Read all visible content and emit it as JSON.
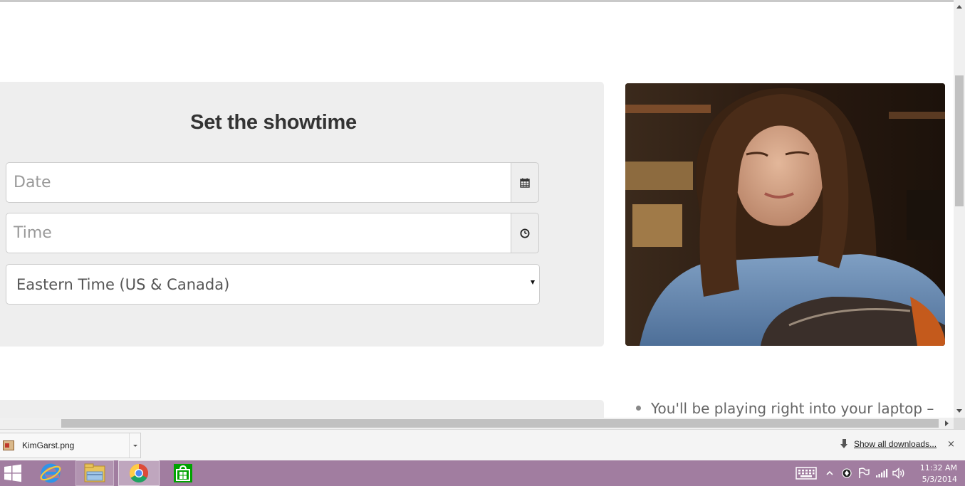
{
  "form": {
    "title": "Set the showtime",
    "date_placeholder": "Date",
    "time_placeholder": "Time",
    "timezone_value": "Eastern Time (US & Canada)"
  },
  "content": {
    "bullet_text": "You'll be playing right into your laptop –"
  },
  "downloads": {
    "file_name": "KimGarst.png",
    "show_all_label": "Show all downloads...",
    "close_label": "×"
  },
  "taskbar": {
    "apps": [
      "start-icon",
      "internet-explorer-icon",
      "file-explorer-icon",
      "chrome-icon",
      "store-icon"
    ],
    "time": "11:32 AM",
    "date": "5/3/2014"
  },
  "colors": {
    "panel_bg": "#eeeeee",
    "taskbar_bg": "#a17da0",
    "title_text": "#333333"
  }
}
